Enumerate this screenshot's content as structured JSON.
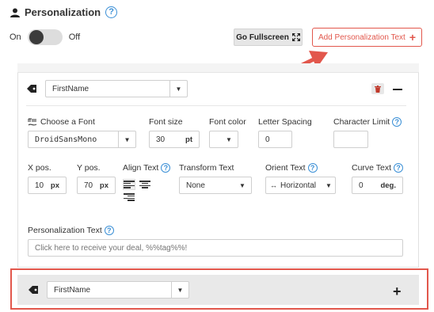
{
  "header": {
    "title": "Personalization",
    "help_glyph": "?"
  },
  "toggle": {
    "on_label": "On",
    "off_label": "Off",
    "state": "off"
  },
  "toolbar": {
    "fullscreen_label": "Go Fullscreen",
    "add_label": "Add Personalization Text",
    "add_plus": "+"
  },
  "field_row": {
    "field_select_value": "FirstName",
    "caret": "▼"
  },
  "form": {
    "font": {
      "label": "Choose a Font",
      "value": "DroidSansMono"
    },
    "font_size": {
      "label": "Font size",
      "value": "30",
      "unit": "pt"
    },
    "font_color": {
      "label": "Font color"
    },
    "letter_spacing": {
      "label": "Letter Spacing",
      "value": "0"
    },
    "char_limit": {
      "label": "Character Limit",
      "value": ""
    },
    "x_pos": {
      "label": "X pos.",
      "value": "10",
      "unit": "px"
    },
    "y_pos": {
      "label": "Y pos.",
      "value": "70",
      "unit": "px"
    },
    "align": {
      "label": "Align Text",
      "selected": "left"
    },
    "transform": {
      "label": "Transform Text",
      "value": "None"
    },
    "orient": {
      "label": "Orient Text",
      "value": "Horizontal",
      "glyph": "↔"
    },
    "curve": {
      "label": "Curve Text",
      "value": "0",
      "unit": "deg."
    },
    "personalization_text": {
      "label": "Personalization Text",
      "placeholder": "Click here to receive your deal, %%tag%%!"
    }
  },
  "bottom_row": {
    "field_select_value": "FirstName",
    "plus": "+"
  },
  "colors": {
    "accent": "#e2574c",
    "help": "#3a8fd6",
    "toggle_knob": "#3b3b3b"
  }
}
